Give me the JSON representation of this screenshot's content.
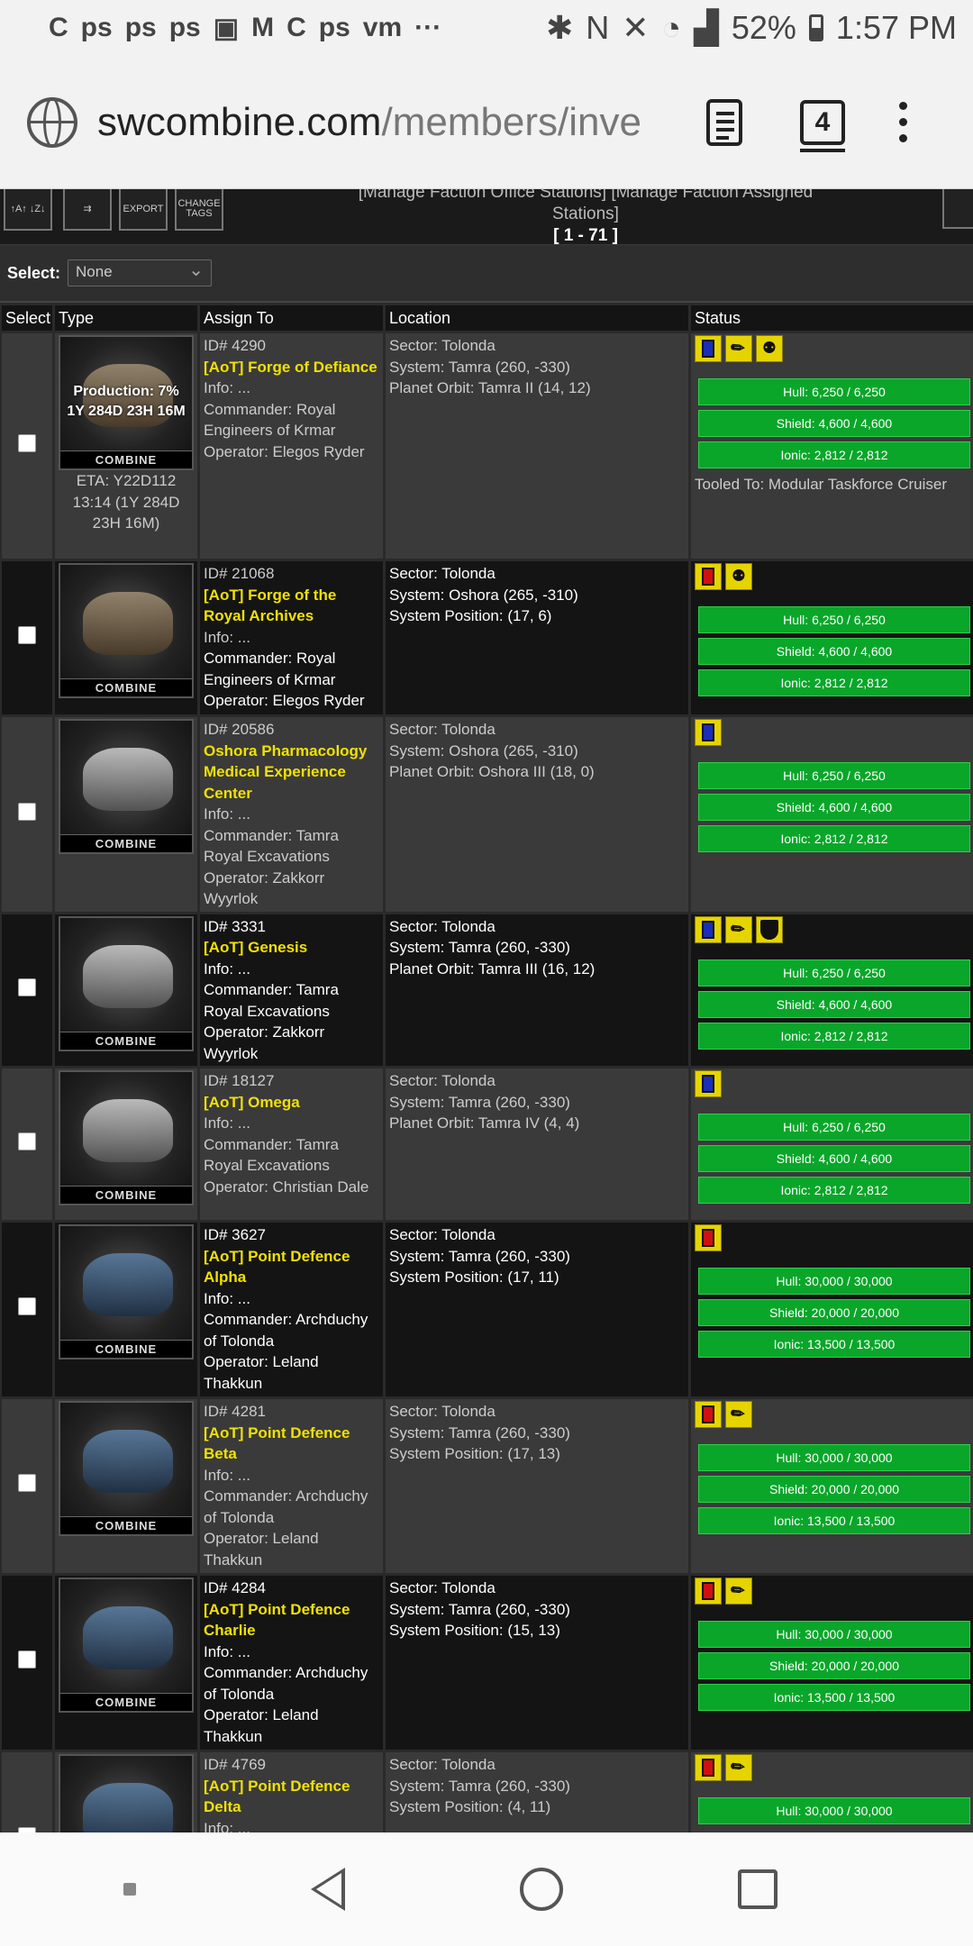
{
  "status_bar": {
    "battery": "52%",
    "time": "1:57 PM",
    "left_icons": [
      "C",
      "ps",
      "ps",
      "ps",
      "▣",
      "M",
      "C",
      "ps",
      "vm",
      "···"
    ],
    "right_icons": [
      "bluetooth-icon",
      "nfc-icon",
      "mute-icon",
      "wifi-icon",
      "signal-icon"
    ]
  },
  "browser": {
    "url_main": "swcombine.com",
    "url_path": "/members/inve",
    "tab_count": "4"
  },
  "toolbar": {
    "buttons": [
      "↑A↑ ↓Z↓",
      "⇉",
      "EXPORT",
      "CHANGE TAGS"
    ],
    "paging_links": "[Manage Faction Office Stations] [Manage Faction Assigned Stations]",
    "range": "[ 1 - 71 ]"
  },
  "select": {
    "label": "Select:",
    "value": "None"
  },
  "table": {
    "headers": [
      "Select",
      "Type",
      "Assign To",
      "Location",
      "Status"
    ],
    "rows": [
      {
        "production": "Production: 7%",
        "production_time": "1Y 284D 23H 16M",
        "eta": "ETA: Y22D112 13:14 (1Y 284D 23H 16M)",
        "id": "ID# 4290",
        "name": "[AoT] Forge of Defiance",
        "info": "Info: ...",
        "commander": "Commander: Royal Engineers of Krmar",
        "operator": "Operator: Elegos Ryder",
        "sector": "Sector: Tolonda",
        "system": "System: Tamra (260, -330)",
        "position": "Planet Orbit: Tamra II (14, 12)",
        "hull": "Hull: 6,250 / 6,250",
        "shield": "Shield: 4,600 / 4,600",
        "ionic": "Ionic: 2,812 / 2,812",
        "tooled": "Tooled To: Modular Taskforce Cruiser"
      },
      {
        "id": "ID# 21068",
        "name": "[AoT] Forge of the Royal Archives",
        "info": "Info: ...",
        "commander": "Commander: Royal Engineers of Krmar",
        "operator": "Operator: Elegos Ryder",
        "sector": "Sector: Tolonda",
        "system": "System: Oshora (265, -310)",
        "position": "System Position: (17, 6)",
        "hull": "Hull: 6,250 / 6,250",
        "shield": "Shield: 4,600 / 4,600",
        "ionic": "Ionic: 2,812 / 2,812"
      },
      {
        "id": "ID# 20586",
        "name": "Oshora Pharmacology Medical Experience Center",
        "info": "Info: ...",
        "commander": "Commander: Tamra Royal Excavations",
        "operator": "Operator: Zakkorr Wyyrlok",
        "sector": "Sector: Tolonda",
        "system": "System: Oshora (265, -310)",
        "position": "Planet Orbit: Oshora III (18, 0)",
        "hull": "Hull: 6,250 / 6,250",
        "shield": "Shield: 4,600 / 4,600",
        "ionic": "Ionic: 2,812 / 2,812"
      },
      {
        "id": "ID# 3331",
        "name": "[AoT] Genesis",
        "info": "Info: ...",
        "commander": "Commander: Tamra Royal Excavations",
        "operator": "Operator: Zakkorr Wyyrlok",
        "sector": "Sector: Tolonda",
        "system": "System: Tamra (260, -330)",
        "position": "Planet Orbit: Tamra III (16, 12)",
        "hull": "Hull: 6,250 / 6,250",
        "shield": "Shield: 4,600 / 4,600",
        "ionic": "Ionic: 2,812 / 2,812"
      },
      {
        "id": "ID# 18127",
        "name": "[AoT] Omega",
        "info": "Info: ...",
        "commander": "Commander: Tamra Royal Excavations",
        "operator": "Operator: Christian Dale",
        "sector": "Sector: Tolonda",
        "system": "System: Tamra (260, -330)",
        "position": "Planet Orbit: Tamra IV (4, 4)",
        "hull": "Hull: 6,250 / 6,250",
        "shield": "Shield: 4,600 / 4,600",
        "ionic": "Ionic: 2,812 / 2,812"
      },
      {
        "id": "ID# 3627",
        "name": "[AoT] Point Defence Alpha",
        "info": "Info: ...",
        "commander": "Commander: Archduchy of Tolonda",
        "operator": "Operator: Leland Thakkun",
        "sector": "Sector: Tolonda",
        "system": "System: Tamra (260, -330)",
        "position": "System Position: (17, 11)",
        "hull": "Hull: 30,000 / 30,000",
        "shield": "Shield: 20,000 / 20,000",
        "ionic": "Ionic: 13,500 / 13,500"
      },
      {
        "id": "ID# 4281",
        "name": "[AoT] Point Defence Beta",
        "info": "Info: ...",
        "commander": "Commander: Archduchy of Tolonda",
        "operator": "Operator: Leland Thakkun",
        "sector": "Sector: Tolonda",
        "system": "System: Tamra (260, -330)",
        "position": "System Position: (17, 13)",
        "hull": "Hull: 30,000 / 30,000",
        "shield": "Shield: 20,000 / 20,000",
        "ionic": "Ionic: 13,500 / 13,500"
      },
      {
        "id": "ID# 4284",
        "name": "[AoT] Point Defence Charlie",
        "info": "Info: ...",
        "commander": "Commander: Archduchy of Tolonda",
        "operator": "Operator: Leland Thakkun",
        "sector": "Sector: Tolonda",
        "system": "System: Tamra (260, -330)",
        "position": "System Position: (15, 13)",
        "hull": "Hull: 30,000 / 30,000",
        "shield": "Shield: 20,000 / 20,000",
        "ionic": "Ionic: 13,500 / 13,500"
      },
      {
        "id": "ID# 4769",
        "name": "[AoT] Point Defence Delta",
        "info": "Info: ...",
        "sector": "Sector: Tolonda",
        "system": "System: Tamra (260, -330)",
        "position": "System Position: (4, 11)",
        "hull": "Hull: 30,000 / 30,000"
      }
    ],
    "combine_label": "COMBINE"
  },
  "colors": {
    "accent_yellow": "#f0e100",
    "bar_green": "#0aa62a",
    "row_light": "#3a3a3a",
    "row_dark": "#141414"
  }
}
